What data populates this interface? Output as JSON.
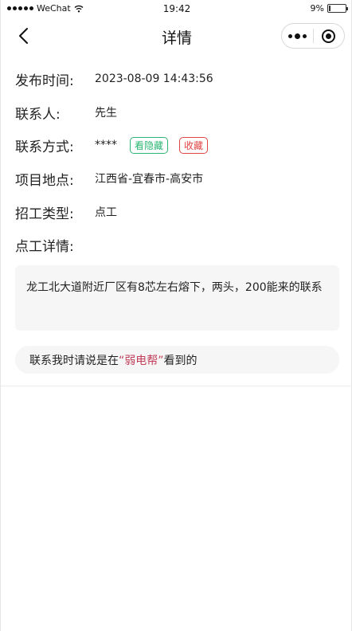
{
  "status_bar": {
    "carrier": "WeChat",
    "time": "19:42",
    "battery_text": "9%",
    "battery_level": 0.09
  },
  "nav": {
    "title": "详情"
  },
  "fields": {
    "publish_time_label": "发布时间:",
    "publish_time_value": "2023-08-09 14:43:56",
    "contact_person_label": "联系人:",
    "contact_person_value": "先生",
    "contact_method_label": "联系方式:",
    "contact_method_value": "****",
    "view_hidden_label": "看隐藏",
    "favorite_label": "收藏",
    "location_label": "项目地点:",
    "location_value": "江西省-宜春市-高安市",
    "job_type_label": "招工类型:",
    "job_type_value": "点工",
    "detail_label": "点工详情:"
  },
  "detail": {
    "text": "龙工北大道附近厂区有8芯左右熔下，两头，200能来的联系"
  },
  "notice": {
    "prefix": "联系我时请说是在",
    "brand": "“弱电帮”",
    "suffix": "看到的"
  },
  "colors": {
    "green_badge": "#2bb673",
    "red_badge": "#e04444",
    "brand_text": "#c2405a",
    "box_bg": "#f6f6f6"
  }
}
